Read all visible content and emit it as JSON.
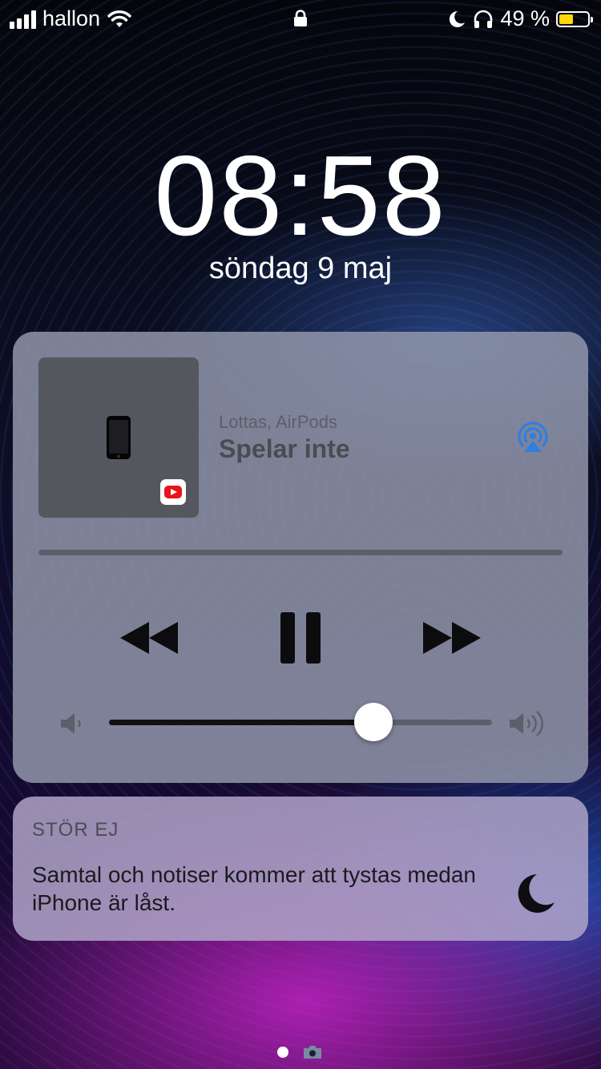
{
  "status_bar": {
    "carrier": "hallon",
    "battery_text": "49 %",
    "battery_level": 0.49,
    "battery_color": "#ffd60a",
    "icons": [
      "signal-icon",
      "wifi-icon",
      "lock-icon",
      "moon-icon",
      "headphones-icon",
      "battery-icon"
    ]
  },
  "lock_screen": {
    "time": "08:58",
    "date": "söndag 9 maj"
  },
  "now_playing": {
    "route": "Lottas, AirPods",
    "status": "Spelar inte",
    "app_badge": "youtube-icon",
    "artwork_icon": "iphone-icon",
    "controls": [
      "rewind-icon",
      "pause-icon",
      "fast-forward-icon"
    ],
    "progress": 0.0,
    "volume": 0.69,
    "accent_color": "#2f7fe0"
  },
  "dnd_notification": {
    "title": "STÖR EJ",
    "body": "Samtal och notiser kommer att tystas medan iPhone är låst."
  },
  "page_indicator": {
    "pages": [
      "lock-page",
      "camera-page"
    ],
    "active": 0
  }
}
